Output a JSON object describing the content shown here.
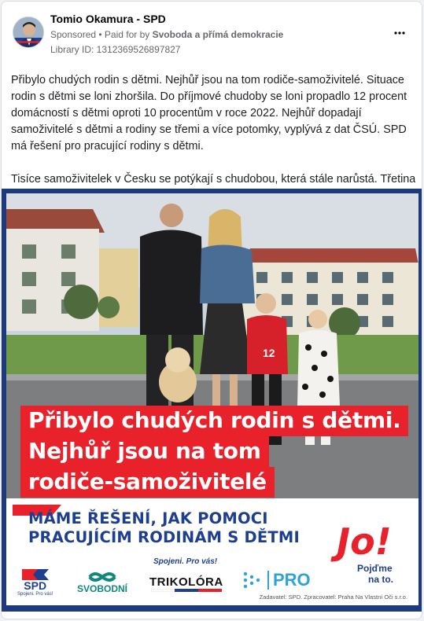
{
  "post": {
    "page_name": "Tomio Okamura - SPD",
    "sponsored_label": "Sponsored",
    "separator": " • ",
    "paid_for_prefix": "Paid for by ",
    "payer": "Svoboda a přímá demokracie",
    "library_id": "Library ID: 1312369526897827",
    "more_icon": "more-horizontal-icon",
    "paragraph_1": "Přibylo chudých rodin s dětmi. Nejhůř jsou na tom rodiče-samoživitelé. Situace rodin s dětmi se loni zhoršila. Do příjmové chudoby se loni propadlo 12 procent domácností s dětmi oproti 10 procentům v roce 2022. Nejhůř dopadají samoživitelé s dětmi a rodiny se třemi a více potomky, vyplývá z dat ČSÚ. SPD má řešení pro pracující rodiny s dětmi.",
    "paragraph_2": "Tisíce samoživitelek v Česku se potýkají s chudobou, která stále narůstá. Třetina …"
  },
  "creative": {
    "headline": [
      "Přibylo chudých rodin s dětmi.",
      "Nejhůř jsou na tom",
      "rodiče-samoživitelé"
    ],
    "solution": [
      "MÁME ŘEŠENÍ, JAK POMOCI",
      "PRACUJÍCÍM RODINÁM S DĚTMI"
    ],
    "slogan": "Spojeni. Pro vás!",
    "jo_text": "Jo!",
    "jo_sub_1": "Pojďme",
    "jo_sub_2": "na to.",
    "logos": {
      "spd": "SPD",
      "spd_tag": "Spojeni. Pro vás!",
      "svobodni": "SVOBODNÍ",
      "trikolora": "TRIKOLÓRA",
      "pro": "PRO"
    },
    "footnote": "Zadavatel: SPD. Zpracovatel: Praha Na Vlastní Oči s.r.o.",
    "player_number": "12",
    "colors": {
      "brand_red": "#e8212a",
      "brand_blue": "#1e3f8f",
      "frame_blue": "#1d3b7a"
    }
  }
}
